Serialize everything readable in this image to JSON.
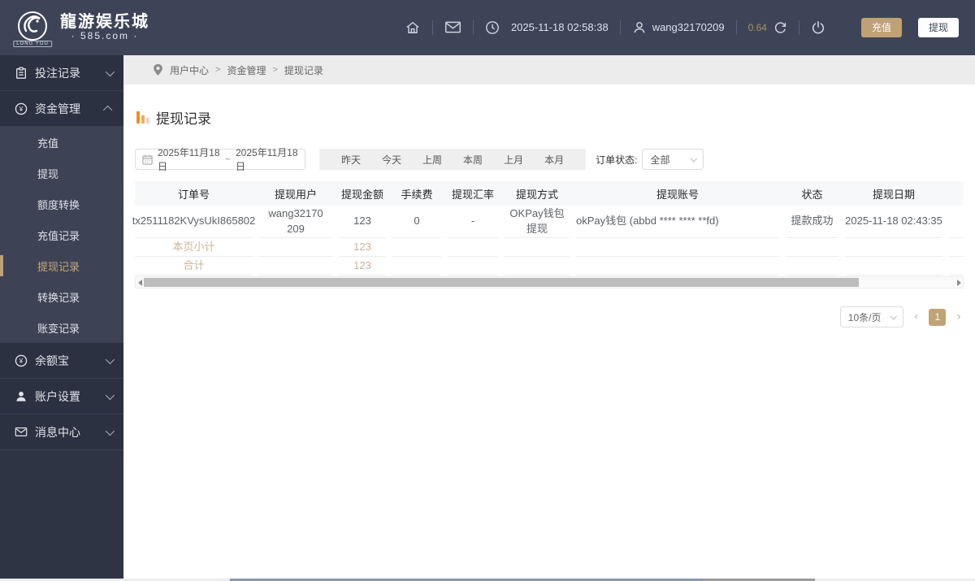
{
  "topbar": {
    "logo": {
      "name": "龍游娱乐城",
      "domain": "· 585.com ·",
      "badge": "LONG YOU"
    },
    "datetime": "2025-11-18 02:58:38",
    "username": "wang32170209",
    "balance": "0.64",
    "recharge": "充值",
    "withdraw": "提现"
  },
  "sidebar": {
    "groups": [
      {
        "label": "投注记录"
      },
      {
        "label": "资金管理"
      },
      {
        "label": "余额宝"
      },
      {
        "label": "账户设置"
      },
      {
        "label": "消息中心"
      }
    ],
    "submenu": [
      "充值",
      "提现",
      "额度转换",
      "充值记录",
      "提现记录",
      "转换记录",
      "账变记录"
    ]
  },
  "breadcrumb": {
    "items": [
      "用户中心",
      "资金管理",
      "提现记录"
    ],
    "sep": ">"
  },
  "page": {
    "title": "提现记录"
  },
  "filters": {
    "date_from": "2025年11月18日",
    "date_sep": "~",
    "date_to": "2025年11月18日",
    "quick": [
      "昨天",
      "今天",
      "上周",
      "本周",
      "上月",
      "本月"
    ],
    "status_label": "订单状态:",
    "status_value": "全部"
  },
  "table": {
    "headers": [
      "订单号",
      "提现用户",
      "提现金额",
      "手续费",
      "提现汇率",
      "提现方式",
      "提现账号",
      "状态",
      "提现日期"
    ],
    "row": {
      "order_no": "tx2511182KVysUkI865802",
      "user": "wang32170209",
      "amount": "123",
      "fee": "0",
      "rate": "-",
      "method": "OKPay钱包提现",
      "account": "okPay钱包 (abbd **** **** **fd)",
      "status": "提款成功",
      "date": "2025-11-18 02:43:35"
    },
    "subtotal_label": "本页小计",
    "subtotal_amount": "123",
    "total_label": "合计",
    "total_amount": "123"
  },
  "pagination": {
    "page_size": "10条/页",
    "current": "1"
  },
  "colors": {
    "accent": "#bfa173",
    "topbar": "#3d4458",
    "active_text": "#c9a878"
  }
}
